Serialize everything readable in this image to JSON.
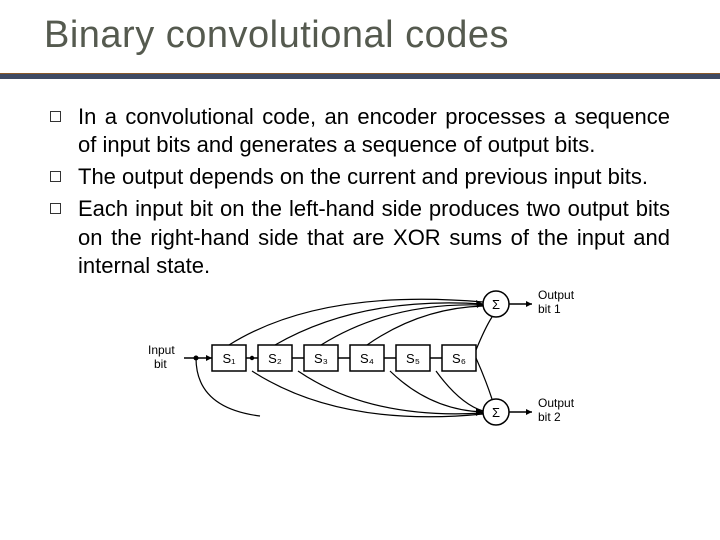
{
  "title": "Binary convolutional codes",
  "bullets": [
    "In a convolutional code, an encoder processes a sequence of input bits and generates a sequence of output bits.",
    "The output depends on the current and previous input bits.",
    "Each input bit on the left-hand side produces two output bits on the right-hand side that are XOR sums of the input and internal state."
  ],
  "diagram": {
    "input_label": [
      "Input",
      "bit"
    ],
    "states": [
      "S₁",
      "S₂",
      "S₃",
      "S₄",
      "S₅",
      "S₆"
    ],
    "sum_symbol": "Σ",
    "output_top": [
      "Output",
      "bit 1"
    ],
    "output_bottom": [
      "Output",
      "bit 2"
    ]
  }
}
